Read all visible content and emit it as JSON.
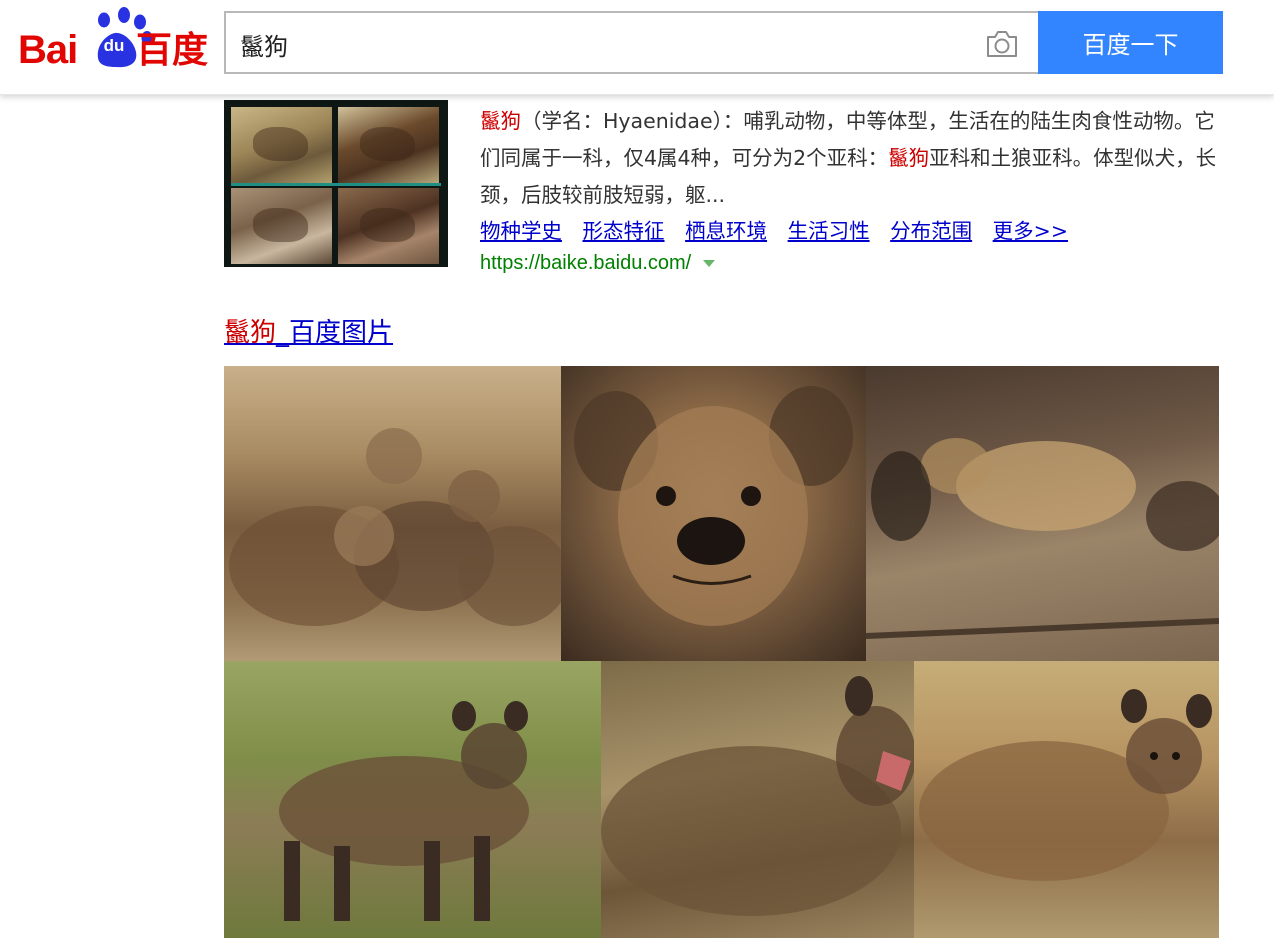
{
  "header": {
    "logo": {
      "text_left": "Bai",
      "text_paw": "du",
      "text_cn": "百度"
    },
    "search": {
      "query": "鬣狗",
      "camera_icon": "camera-icon"
    },
    "search_button_label": "百度一下",
    "colors": {
      "brand_red": "#e10602",
      "brand_blue": "#2932e1",
      "button_blue": "#3385ff"
    }
  },
  "result_baike": {
    "abstract": {
      "keyword": "鬣狗",
      "part1": "（学名：Hyaenidae）：哺乳动物，中等体型，生活在的陆生肉食性动物。它们同属于一科，仅4属4种，可分为2个亚科：",
      "keyword2": "鬣狗",
      "part2": "亚科和土狼亚科。体型似犬，长颈，后肢较前肢短弱，躯..."
    },
    "sublinks": [
      "物种学史",
      "形态特征",
      "栖息环境",
      "生活习性",
      "分布范围",
      "更多>>"
    ],
    "url": "https://baike.baidu.com/"
  },
  "images_section": {
    "title_keyword": "鬣狗",
    "title_suffix": "_百度图片"
  }
}
